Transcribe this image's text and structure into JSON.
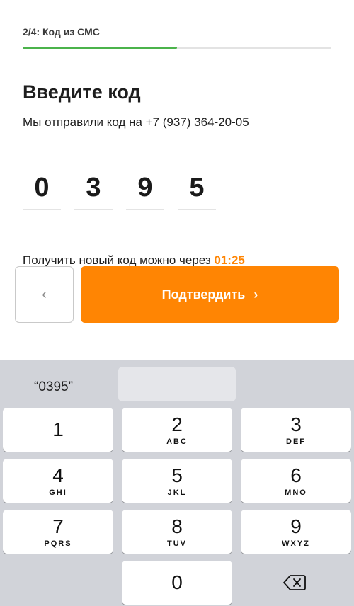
{
  "header": {
    "step_label": "2/4: Код из СМС",
    "progress": 0.5
  },
  "content": {
    "title": "Введите код",
    "subtitle": "Мы отправили код на +7 (937) 364-20-05",
    "code_digits": [
      "0",
      "3",
      "9",
      "5"
    ],
    "resend_prefix": "Получить новый код можно через",
    "resend_timer": "01:25"
  },
  "actions": {
    "back_glyph": "‹",
    "confirm_label": "Подтвердить",
    "confirm_arrow": "›"
  },
  "keyboard": {
    "suggestion": "“0395”",
    "keys": [
      {
        "digit": "1",
        "letters": ""
      },
      {
        "digit": "2",
        "letters": "ABC"
      },
      {
        "digit": "3",
        "letters": "DEF"
      },
      {
        "digit": "4",
        "letters": "GHI"
      },
      {
        "digit": "5",
        "letters": "JKL"
      },
      {
        "digit": "6",
        "letters": "MNO"
      },
      {
        "digit": "7",
        "letters": "PQRS"
      },
      {
        "digit": "8",
        "letters": "TUV"
      },
      {
        "digit": "9",
        "letters": "WXYZ"
      },
      {
        "digit": "0",
        "letters": ""
      }
    ],
    "delete_icon": "backspace-icon"
  },
  "colors": {
    "accent_orange": "#ff8503",
    "progress_green": "#4bb34b"
  }
}
